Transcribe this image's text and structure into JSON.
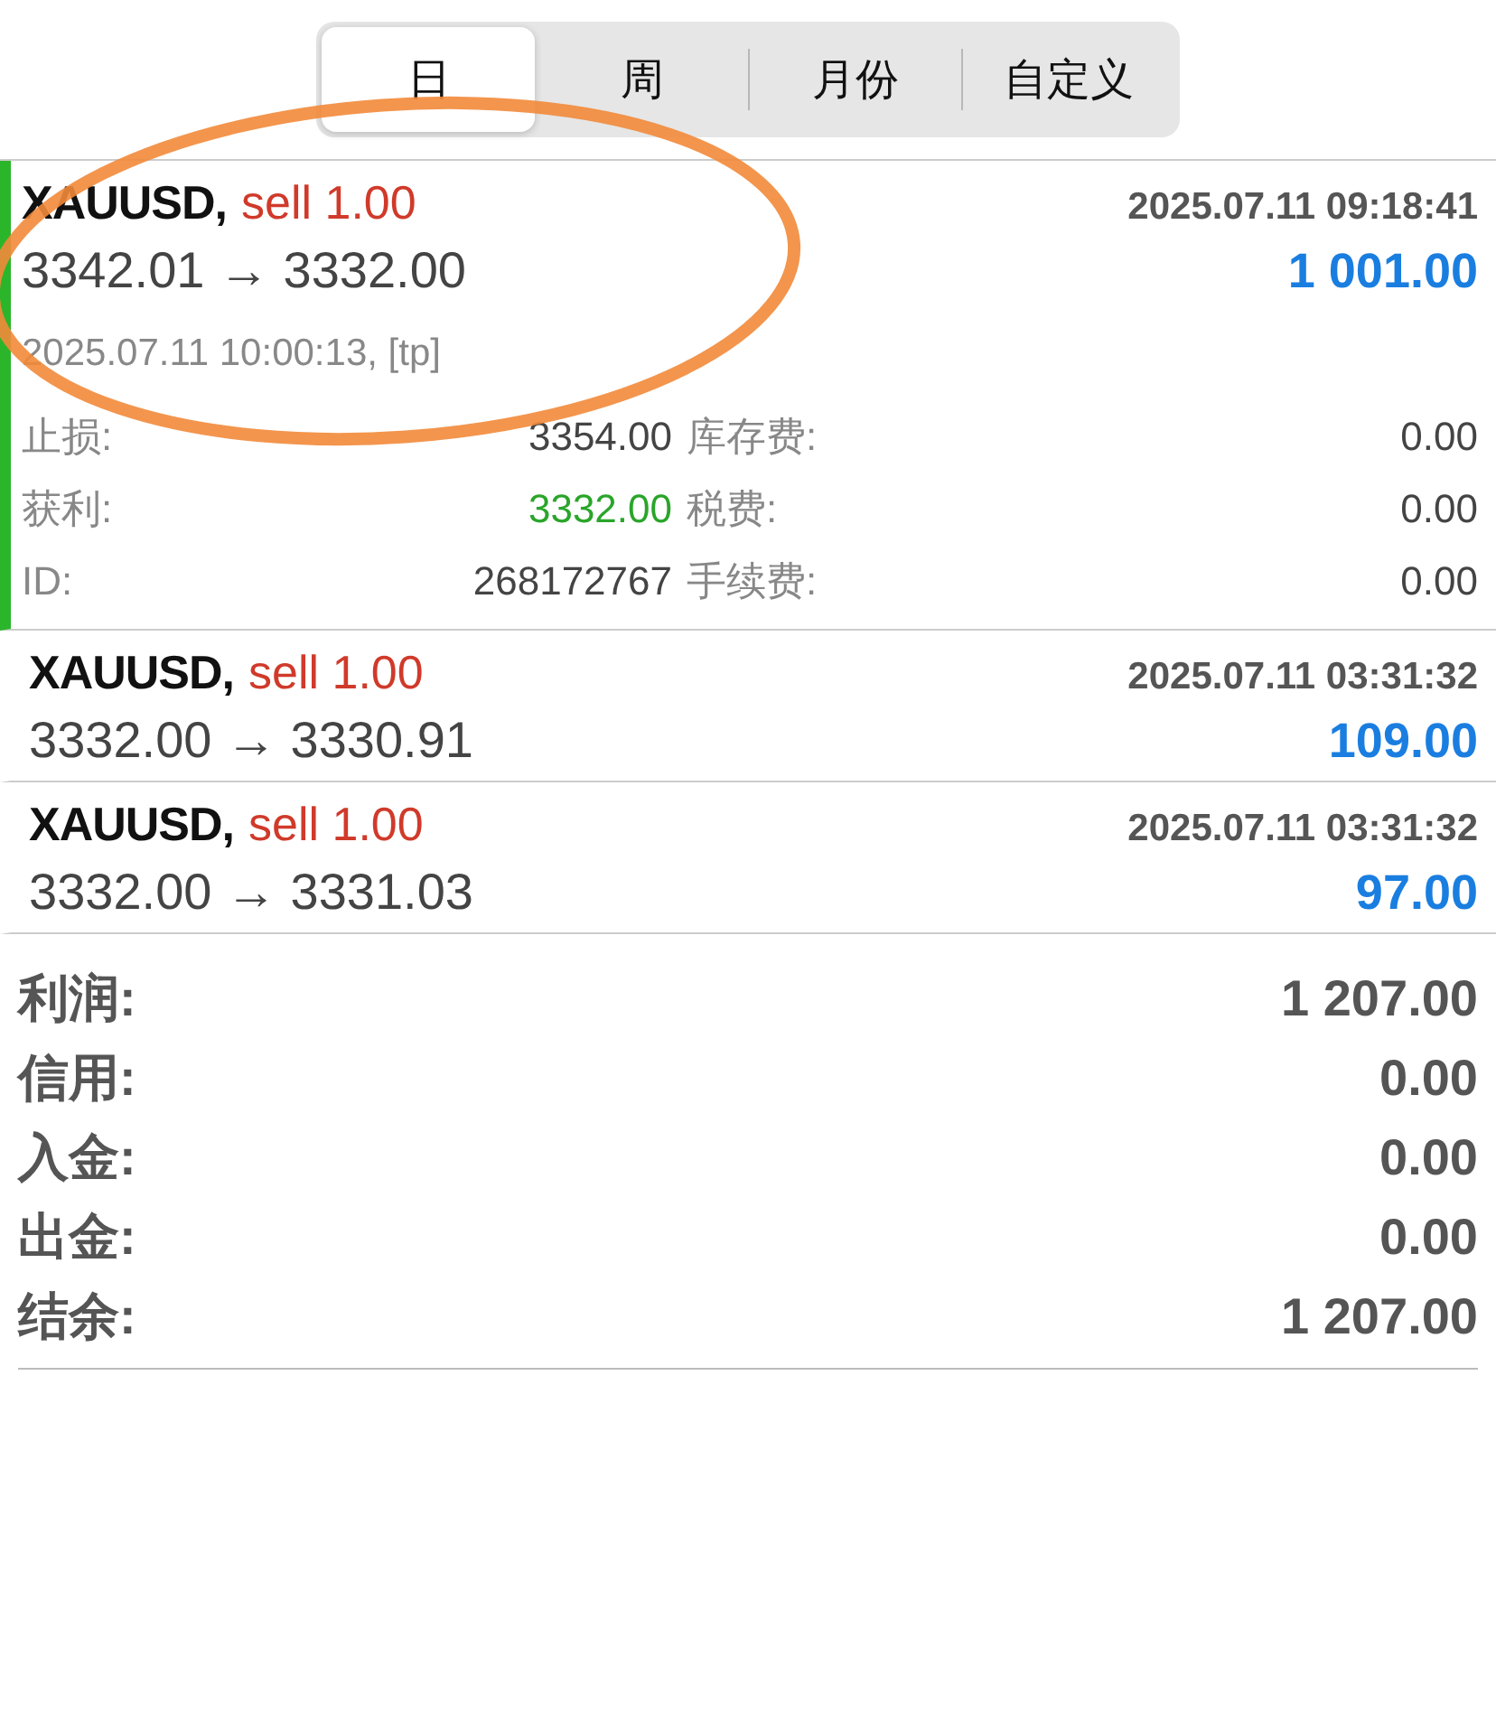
{
  "tabs": [
    {
      "label": "日",
      "selected": true
    },
    {
      "label": "周",
      "selected": false
    },
    {
      "label": "月份",
      "selected": false
    },
    {
      "label": "自定义",
      "selected": false
    }
  ],
  "trades": [
    {
      "symbol": "XAUUSD,",
      "side": "sell 1.00",
      "time": "2025.07.11 09:18:41",
      "prices": "3342.01 → 3332.00",
      "profit": "1 001.00",
      "expanded": true,
      "close_info": "2025.07.11 10:00:13, [tp]",
      "details": [
        {
          "left_label": "止损:",
          "left_value": "3354.00",
          "left_take_profit": false,
          "right_label": "库存费:",
          "right_value": "0.00"
        },
        {
          "left_label": "获利:",
          "left_value": "3332.00",
          "left_take_profit": true,
          "right_label": "税费:",
          "right_value": "0.00"
        },
        {
          "left_label": "ID:",
          "left_value": "268172767",
          "left_take_profit": false,
          "right_label": "手续费:",
          "right_value": "0.00"
        }
      ]
    },
    {
      "symbol": "XAUUSD,",
      "side": "sell 1.00",
      "time": "2025.07.11 03:31:32",
      "prices": "3332.00 → 3330.91",
      "profit": "109.00",
      "expanded": false
    },
    {
      "symbol": "XAUUSD,",
      "side": "sell 1.00",
      "time": "2025.07.11 03:31:32",
      "prices": "3332.00 → 3331.03",
      "profit": "97.00",
      "expanded": false
    }
  ],
  "summary": [
    {
      "label": "利润:",
      "value": "1 207.00"
    },
    {
      "label": "信用:",
      "value": "0.00"
    },
    {
      "label": "入金:",
      "value": "0.00"
    },
    {
      "label": "出金:",
      "value": "0.00"
    },
    {
      "label": "结余:",
      "value": "1 207.00"
    }
  ]
}
